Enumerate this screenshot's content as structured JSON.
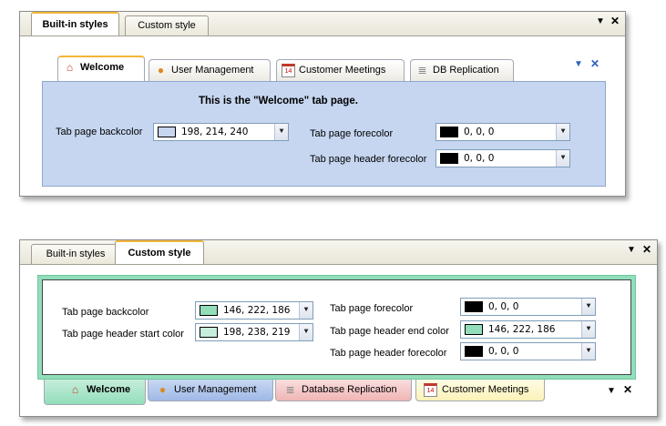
{
  "top": {
    "tabs": [
      {
        "label": "Built-in styles",
        "active": true
      },
      {
        "label": "Custom style",
        "active": false
      }
    ],
    "ctrl_pin": "▼",
    "ctrl_close": "✕",
    "inner_ctrl_pin": "▼",
    "inner_ctrl_close": "✕",
    "inner_tabs": [
      {
        "label": "Welcome",
        "icon": "home-icon"
      },
      {
        "label": "User Management",
        "icon": "users-icon"
      },
      {
        "label": "Customer Meetings",
        "icon": "calendar-icon",
        "icon_text": "14"
      },
      {
        "label": "DB Replication",
        "icon": "database-icon"
      }
    ],
    "heading": "This is the \"Welcome\"  tab page.",
    "fields": {
      "backcolor": {
        "label": "Tab page backcolor",
        "value": "198, 214, 240",
        "swatch": "#c6d6f0"
      },
      "forecolor": {
        "label": "Tab page forecolor",
        "value": "0, 0, 0",
        "swatch": "#000000"
      },
      "header_forecolor": {
        "label": "Tab page header forecolor",
        "value": "0, 0, 0",
        "swatch": "#000000"
      }
    },
    "colors": {
      "panel": "#c6d6f0",
      "panel_border": "#8ea7cf"
    }
  },
  "bottom": {
    "tabs": [
      {
        "label": "Built-in styles",
        "active": false
      },
      {
        "label": "Custom style",
        "active": true
      }
    ],
    "ctrl_pin": "▼",
    "ctrl_close": "✕",
    "inner_ctrl_pin": "▼",
    "inner_ctrl_close": "✕",
    "fields": {
      "backcolor": {
        "label": "Tab page backcolor",
        "value": "146, 222, 186",
        "swatch": "#92deba"
      },
      "header_start": {
        "label": "Tab page header start color",
        "value": "198, 238, 219",
        "swatch": "#c6eedb"
      },
      "forecolor": {
        "label": "Tab page forecolor",
        "value": "0, 0, 0",
        "swatch": "#000000"
      },
      "header_end": {
        "label": "Tab page header end color",
        "value": "146, 222, 186",
        "swatch": "#92deba"
      },
      "header_forecolor": {
        "label": "Tab page header forecolor",
        "value": "0, 0, 0",
        "swatch": "#000000"
      }
    },
    "bottom_tabs": [
      {
        "label": "Welcome",
        "icon": "home-icon"
      },
      {
        "label": "User Management",
        "icon": "users-icon"
      },
      {
        "label": "Database Replication",
        "icon": "database-icon"
      },
      {
        "label": "Customer Meetings",
        "icon": "calendar-icon",
        "icon_text": "14"
      }
    ],
    "colors": {
      "frame": "#92deba",
      "frame_dark": "#6fc79e"
    }
  }
}
